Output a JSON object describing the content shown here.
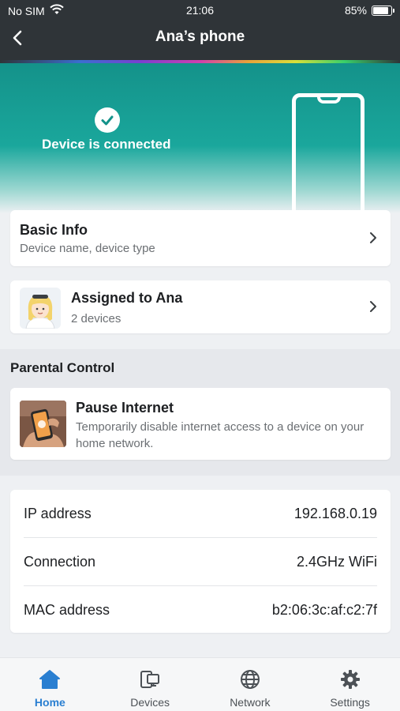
{
  "status_bar": {
    "carrier": "No SIM",
    "time": "21:06",
    "battery": "85%"
  },
  "header": {
    "title": "Ana’s phone"
  },
  "hero": {
    "status_text": "Device is connected"
  },
  "basic_info": {
    "title": "Basic Info",
    "subtitle": "Device name, device type"
  },
  "assigned": {
    "title": "Assigned to Ana",
    "subtitle": "2 devices"
  },
  "parental_control": {
    "section_title": "Parental Control",
    "pause_title": "Pause Internet",
    "pause_description": "Temporarily disable internet access to a device on your home network."
  },
  "details": [
    {
      "label": "IP address",
      "value": "192.168.0.19"
    },
    {
      "label": "Connection",
      "value": "2.4GHz WiFi"
    },
    {
      "label": "MAC address",
      "value": "b2:06:3c:af:c2:7f"
    }
  ],
  "tabs": [
    {
      "label": "Home",
      "icon": "home-icon",
      "active": true
    },
    {
      "label": "Devices",
      "icon": "devices-icon",
      "active": false
    },
    {
      "label": "Network",
      "icon": "globe-icon",
      "active": false
    },
    {
      "label": "Settings",
      "icon": "gear-icon",
      "active": false
    }
  ],
  "colors": {
    "accent": "#2a7fd1",
    "hero": "#1aa79c",
    "header": "#2f3438"
  }
}
